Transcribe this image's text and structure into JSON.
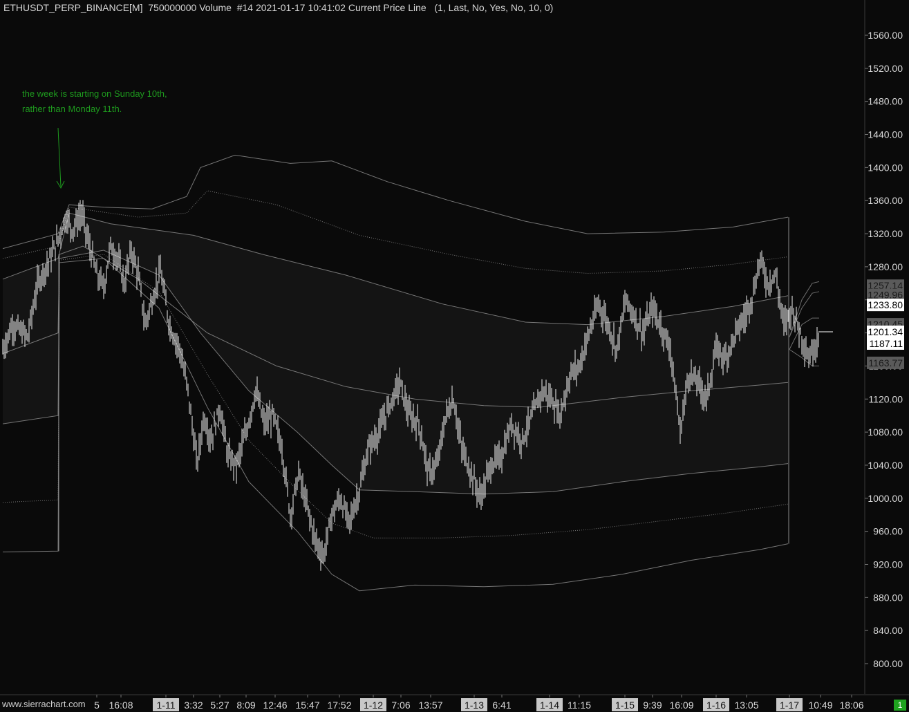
{
  "header": {
    "title": "ETHUSDT_PERP_BINANCE[M]  750000000 Volume  #14 2021-01-17 10:41:02 Current Price Line   (1, Last, No, Yes, No, 10, 0)"
  },
  "annotation": {
    "line1": "the week is starting on Sunday 10th,",
    "line2": "rather than Monday 11th."
  },
  "footer": {
    "url": "www.sierrachart.com",
    "badge": "1"
  },
  "colors": {
    "background": "#0a0a0a",
    "bars": "#f2f2f2",
    "bands": "#8a8a8a",
    "annotation": "#1e9a1e",
    "axis_text": "#d9d9d9",
    "date_box": "#c8c8c8"
  },
  "chart_data": {
    "type": "bar",
    "description_series": "OHLC price bars (approximate close path)",
    "y_axis": {
      "ticks": [
        1560,
        1520,
        1480,
        1440,
        1400,
        1360,
        1320,
        1280,
        1240,
        1200,
        1160,
        1120,
        1080,
        1040,
        1000,
        960,
        920,
        880,
        840,
        800
      ],
      "tick_labels": [
        "1560.00",
        "1520.00",
        "1480.00",
        "1440.00",
        "1400.00",
        "1360.00",
        "1320.00",
        "1280.00",
        "1240.00",
        "1200.00",
        "1160.00",
        "1120.00",
        "1080.00",
        "1040.00",
        "1000.00",
        "960.00",
        "920.00",
        "880.00",
        "840.00",
        "800.00"
      ],
      "ylim": [
        772,
        1585
      ]
    },
    "price_labels": [
      {
        "text": "1257.14",
        "value": 1257.14,
        "style": "gray"
      },
      {
        "text": "1249.96",
        "value": 1246.0,
        "style": "gray"
      },
      {
        "text": "1233.80",
        "value": 1233.8,
        "style": "white"
      },
      {
        "text": "1210.45",
        "value": 1210.45,
        "style": "gray"
      },
      {
        "text": "1201.34",
        "value": 1201.34,
        "style": "white"
      },
      {
        "text": "1187.11",
        "value": 1187.11,
        "style": "white"
      },
      {
        "text": "1163.77",
        "value": 1163.77,
        "style": "gray"
      }
    ],
    "x_labels": [
      {
        "text": "5",
        "xi": 140,
        "date": false
      },
      {
        "text": "16:08",
        "xi": 175,
        "date": false
      },
      {
        "text": "1-11",
        "xi": 240,
        "date": true
      },
      {
        "text": "3:32",
        "xi": 280,
        "date": false
      },
      {
        "text": "5:27",
        "xi": 318,
        "date": false
      },
      {
        "text": "8:09",
        "xi": 356,
        "date": false
      },
      {
        "text": "12:46",
        "xi": 398,
        "date": false
      },
      {
        "text": "15:47",
        "xi": 445,
        "date": false
      },
      {
        "text": "17:52",
        "xi": 491,
        "date": false
      },
      {
        "text": "1-12",
        "xi": 540,
        "date": true
      },
      {
        "text": "7:06",
        "xi": 580,
        "date": false
      },
      {
        "text": "13:57",
        "xi": 623,
        "date": false
      },
      {
        "text": "1-13",
        "xi": 686,
        "date": true
      },
      {
        "text": "6:41",
        "xi": 726,
        "date": false
      },
      {
        "text": "1-14",
        "xi": 795,
        "date": true
      },
      {
        "text": "11:15",
        "xi": 838,
        "date": false
      },
      {
        "text": "1-15",
        "xi": 904,
        "date": true
      },
      {
        "text": "9:39",
        "xi": 944,
        "date": false
      },
      {
        "text": "16:09",
        "xi": 986,
        "date": false
      },
      {
        "text": "1-16",
        "xi": 1036,
        "date": true
      },
      {
        "text": "13:05",
        "xi": 1080,
        "date": false
      },
      {
        "text": "1-17",
        "xi": 1142,
        "date": true
      },
      {
        "text": "10:49",
        "xi": 1187,
        "date": false
      },
      {
        "text": "18:06",
        "xi": 1232,
        "date": false
      }
    ],
    "price_path": [
      [
        4,
        1180
      ],
      [
        18,
        1210
      ],
      [
        40,
        1195
      ],
      [
        55,
        1262
      ],
      [
        70,
        1285
      ],
      [
        85,
        1315
      ],
      [
        95,
        1340
      ],
      [
        105,
        1325
      ],
      [
        118,
        1345
      ],
      [
        128,
        1310
      ],
      [
        140,
        1270
      ],
      [
        150,
        1255
      ],
      [
        160,
        1305
      ],
      [
        170,
        1290
      ],
      [
        180,
        1260
      ],
      [
        190,
        1300
      ],
      [
        200,
        1270
      ],
      [
        210,
        1210
      ],
      [
        220,
        1240
      ],
      [
        232,
        1275
      ],
      [
        245,
        1210
      ],
      [
        260,
        1180
      ],
      [
        272,
        1130
      ],
      [
        285,
        1040
      ],
      [
        295,
        1100
      ],
      [
        305,
        1070
      ],
      [
        318,
        1110
      ],
      [
        330,
        1050
      ],
      [
        342,
        1040
      ],
      [
        356,
        1080
      ],
      [
        370,
        1130
      ],
      [
        382,
        1090
      ],
      [
        395,
        1100
      ],
      [
        408,
        1060
      ],
      [
        420,
        980
      ],
      [
        432,
        1030
      ],
      [
        444,
        990
      ],
      [
        456,
        950
      ],
      [
        468,
        930
      ],
      [
        480,
        980
      ],
      [
        492,
        1000
      ],
      [
        505,
        970
      ],
      [
        520,
        1010
      ],
      [
        533,
        1060
      ],
      [
        548,
        1080
      ],
      [
        562,
        1110
      ],
      [
        578,
        1140
      ],
      [
        592,
        1100
      ],
      [
        606,
        1090
      ],
      [
        620,
        1030
      ],
      [
        632,
        1040
      ],
      [
        645,
        1100
      ],
      [
        656,
        1120
      ],
      [
        668,
        1060
      ],
      [
        682,
        1030
      ],
      [
        695,
        1000
      ],
      [
        710,
        1040
      ],
      [
        725,
        1050
      ],
      [
        740,
        1090
      ],
      [
        755,
        1070
      ],
      [
        770,
        1100
      ],
      [
        784,
        1130
      ],
      [
        798,
        1120
      ],
      [
        810,
        1100
      ],
      [
        825,
        1150
      ],
      [
        838,
        1160
      ],
      [
        852,
        1200
      ],
      [
        866,
        1235
      ],
      [
        880,
        1210
      ],
      [
        892,
        1180
      ],
      [
        905,
        1240
      ],
      [
        918,
        1220
      ],
      [
        930,
        1200
      ],
      [
        944,
        1230
      ],
      [
        958,
        1205
      ],
      [
        970,
        1180
      ],
      [
        984,
        1080
      ],
      [
        996,
        1150
      ],
      [
        1010,
        1140
      ],
      [
        1022,
        1120
      ],
      [
        1036,
        1180
      ],
      [
        1050,
        1170
      ],
      [
        1064,
        1200
      ],
      [
        1078,
        1220
      ],
      [
        1090,
        1250
      ],
      [
        1100,
        1290
      ],
      [
        1110,
        1260
      ],
      [
        1122,
        1270
      ],
      [
        1134,
        1210
      ],
      [
        1146,
        1230
      ],
      [
        1158,
        1200
      ],
      [
        1170,
        1170
      ],
      [
        1180,
        1187
      ],
      [
        1185,
        1201
      ]
    ],
    "bands": [
      {
        "name": "vwap",
        "style": "solid",
        "pts": [
          [
            4,
            1175
          ],
          [
            84,
            1200
          ],
          [
            86,
            1295
          ],
          [
            120,
            1305
          ],
          [
            200,
            1265
          ],
          [
            300,
            1200
          ],
          [
            400,
            1160
          ],
          [
            500,
            1135
          ],
          [
            600,
            1120
          ],
          [
            700,
            1112
          ],
          [
            780,
            1110
          ],
          [
            800,
            1112
          ],
          [
            900,
            1122
          ],
          [
            1000,
            1130
          ],
          [
            1100,
            1137
          ],
          [
            1140,
            1140
          ]
        ]
      },
      {
        "name": "upper1",
        "style": "solid",
        "pts": [
          [
            4,
            1265
          ],
          [
            84,
            1290
          ],
          [
            100,
            1345
          ],
          [
            160,
            1332
          ],
          [
            280,
            1318
          ],
          [
            380,
            1295
          ],
          [
            500,
            1270
          ],
          [
            640,
            1235
          ],
          [
            760,
            1213
          ],
          [
            850,
            1210
          ],
          [
            960,
            1220
          ],
          [
            1060,
            1232
          ],
          [
            1140,
            1245
          ]
        ]
      },
      {
        "name": "upper2",
        "style": "dotted",
        "pts": [
          [
            4,
            1290
          ],
          [
            84,
            1305
          ],
          [
            100,
            1352
          ],
          [
            200,
            1340
          ],
          [
            270,
            1345
          ],
          [
            300,
            1372
          ],
          [
            400,
            1355
          ],
          [
            520,
            1318
          ],
          [
            650,
            1295
          ],
          [
            760,
            1278
          ],
          [
            850,
            1272
          ],
          [
            960,
            1275
          ],
          [
            1060,
            1283
          ],
          [
            1140,
            1292
          ]
        ]
      },
      {
        "name": "upper3",
        "style": "solid",
        "pts": [
          [
            4,
            1302
          ],
          [
            84,
            1320
          ],
          [
            100,
            1355
          ],
          [
            150,
            1352
          ],
          [
            220,
            1350
          ],
          [
            270,
            1365
          ],
          [
            290,
            1400
          ],
          [
            340,
            1415
          ],
          [
            420,
            1405
          ],
          [
            480,
            1408
          ],
          [
            560,
            1383
          ],
          [
            650,
            1360
          ],
          [
            760,
            1335
          ],
          [
            850,
            1320
          ],
          [
            960,
            1322
          ],
          [
            1060,
            1328
          ],
          [
            1140,
            1340
          ]
        ]
      },
      {
        "name": "lower1",
        "style": "solid",
        "pts": [
          [
            4,
            1090
          ],
          [
            84,
            1100
          ],
          [
            86,
            1290
          ],
          [
            150,
            1300
          ],
          [
            230,
            1270
          ],
          [
            290,
            1200
          ],
          [
            360,
            1130
          ],
          [
            430,
            1080
          ],
          [
            480,
            1040
          ],
          [
            520,
            1010
          ],
          [
            600,
            1008
          ],
          [
            700,
            1005
          ],
          [
            800,
            1008
          ],
          [
            900,
            1020
          ],
          [
            1000,
            1030
          ],
          [
            1100,
            1038
          ],
          [
            1140,
            1042
          ]
        ]
      },
      {
        "name": "lower2",
        "style": "dotted",
        "pts": [
          [
            4,
            995
          ],
          [
            84,
            998
          ],
          [
            86,
            1288
          ],
          [
            150,
            1295
          ],
          [
            230,
            1250
          ],
          [
            300,
            1150
          ],
          [
            360,
            1070
          ],
          [
            430,
            1010
          ],
          [
            480,
            970
          ],
          [
            540,
            952
          ],
          [
            640,
            952
          ],
          [
            740,
            955
          ],
          [
            850,
            962
          ],
          [
            950,
            972
          ],
          [
            1050,
            982
          ],
          [
            1140,
            993
          ]
        ]
      },
      {
        "name": "lower3",
        "style": "solid",
        "pts": [
          [
            4,
            935
          ],
          [
            84,
            936
          ],
          [
            86,
            1285
          ],
          [
            150,
            1290
          ],
          [
            230,
            1230
          ],
          [
            300,
            1110
          ],
          [
            360,
            1020
          ],
          [
            430,
            960
          ],
          [
            480,
            908
          ],
          [
            520,
            888
          ],
          [
            600,
            895
          ],
          [
            700,
            893
          ],
          [
            800,
            896
          ],
          [
            900,
            908
          ],
          [
            1000,
            925
          ],
          [
            1100,
            938
          ],
          [
            1140,
            945
          ]
        ]
      }
    ],
    "right_bands": [
      {
        "pts": [
          [
            1142,
            1195
          ],
          [
            1160,
            1230
          ],
          [
            1175,
            1248
          ],
          [
            1185,
            1250
          ]
        ]
      },
      {
        "pts": [
          [
            1142,
            1195
          ],
          [
            1160,
            1240
          ],
          [
            1175,
            1260
          ],
          [
            1185,
            1262
          ]
        ]
      },
      {
        "pts": [
          [
            1142,
            1180
          ],
          [
            1160,
            1210
          ],
          [
            1175,
            1218
          ],
          [
            1185,
            1218
          ]
        ]
      },
      {
        "pts": [
          [
            1142,
            1180
          ],
          [
            1160,
            1170
          ],
          [
            1175,
            1160
          ],
          [
            1185,
            1160
          ]
        ]
      }
    ]
  }
}
